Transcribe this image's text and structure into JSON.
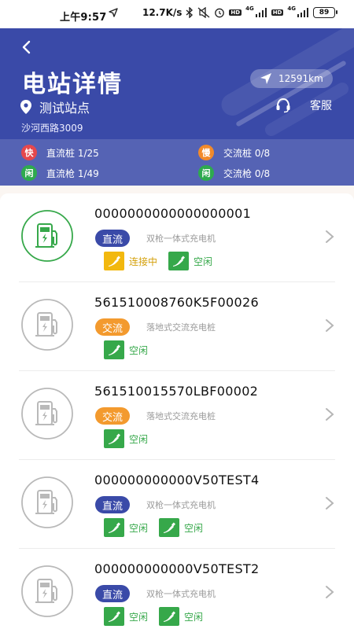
{
  "status_bar": {
    "time": "上午9:57",
    "net_speed": "12.7K/s",
    "net_4g_1": "4G",
    "net_4g_2": "4G",
    "hd1": "HD",
    "hd2": "HD",
    "battery": "89"
  },
  "header": {
    "title": "电站详情",
    "distance": "12591km",
    "station_name": "测试站点",
    "service_label": "客服",
    "address": "沙河西路3009",
    "stats": [
      {
        "badge": "快",
        "label": "直流桩 1/25",
        "color": "#e5484d"
      },
      {
        "badge": "慢",
        "label": "交流桩 0/8",
        "color": "#f28a2a"
      },
      {
        "badge": "闲",
        "label": "直流枪 1/49",
        "color": "#2eaa4e"
      },
      {
        "badge": "闲",
        "label": "交流枪 0/8",
        "color": "#2eaa4e"
      }
    ]
  },
  "colors": {
    "brand": "#3a4aa8",
    "dc_tag": "#3a4aa8",
    "ac_tag": "#f39a2e",
    "idle_green": "#36a84a",
    "connecting_yellow": "#f2b80f"
  },
  "items": [
    {
      "code": "0000000000000000001",
      "type": "直流",
      "type_color": "#3a4aa8",
      "desc": "双枪一体式充电机",
      "active": true,
      "guns": [
        {
          "status": "连接中",
          "color": "#f2b80f",
          "text_color": "#d4a00a"
        },
        {
          "status": "空闲",
          "color": "#36a84a",
          "text_color": "#36a84a"
        }
      ]
    },
    {
      "code": "561510008760K5F00026",
      "type": "交流",
      "type_color": "#f39a2e",
      "desc": "落地式交流充电桩",
      "active": false,
      "guns": [
        {
          "status": "空闲",
          "color": "#36a84a",
          "text_color": "#36a84a"
        }
      ]
    },
    {
      "code": "561510015570LBF00002",
      "type": "交流",
      "type_color": "#f39a2e",
      "desc": "落地式交流充电桩",
      "active": false,
      "guns": [
        {
          "status": "空闲",
          "color": "#36a84a",
          "text_color": "#36a84a"
        }
      ]
    },
    {
      "code": "000000000000V50TEST4",
      "type": "直流",
      "type_color": "#3a4aa8",
      "desc": "双枪一体式充电机",
      "active": false,
      "guns": [
        {
          "status": "空闲",
          "color": "#36a84a",
          "text_color": "#36a84a"
        },
        {
          "status": "空闲",
          "color": "#36a84a",
          "text_color": "#36a84a"
        }
      ]
    },
    {
      "code": "000000000000V50TEST2",
      "type": "直流",
      "type_color": "#3a4aa8",
      "desc": "双枪一体式充电机",
      "active": false,
      "guns": [
        {
          "status": "空闲",
          "color": "#36a84a",
          "text_color": "#36a84a"
        },
        {
          "status": "空闲",
          "color": "#36a84a",
          "text_color": "#36a84a"
        }
      ]
    }
  ]
}
